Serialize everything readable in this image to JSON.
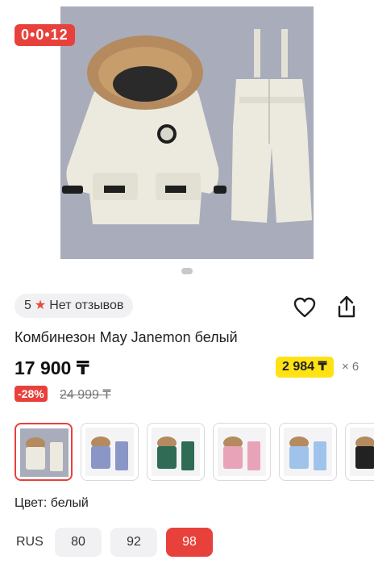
{
  "promo": {
    "timer": "0•0•12"
  },
  "rating": {
    "score": "5",
    "reviews": "Нет отзывов"
  },
  "product": {
    "title": "Комбинезон May Janemon белый",
    "price": "17 900 ₸",
    "installment": "2 984 ₸",
    "installment_multiplier": "× 6",
    "discount": "-28%",
    "old_price": "24 999 ₸"
  },
  "variants": [
    {
      "color": "#ece9de",
      "selected": true
    },
    {
      "color": "#8a96c6",
      "selected": false
    },
    {
      "color": "#2f6b55",
      "selected": false
    },
    {
      "color": "#e9a3b8",
      "selected": false
    },
    {
      "color": "#9fc3ea",
      "selected": false
    },
    {
      "color": "#222222",
      "selected": false
    }
  ],
  "color_label": "Цвет: белый",
  "sizes": {
    "system": "RUS",
    "options": [
      {
        "label": "80",
        "active": false
      },
      {
        "label": "92",
        "active": false
      },
      {
        "label": "98",
        "active": true
      }
    ]
  },
  "colors": {
    "accent": "#e8413b",
    "installment_bg": "#ffe213",
    "hero_bg": "#a9acba"
  }
}
